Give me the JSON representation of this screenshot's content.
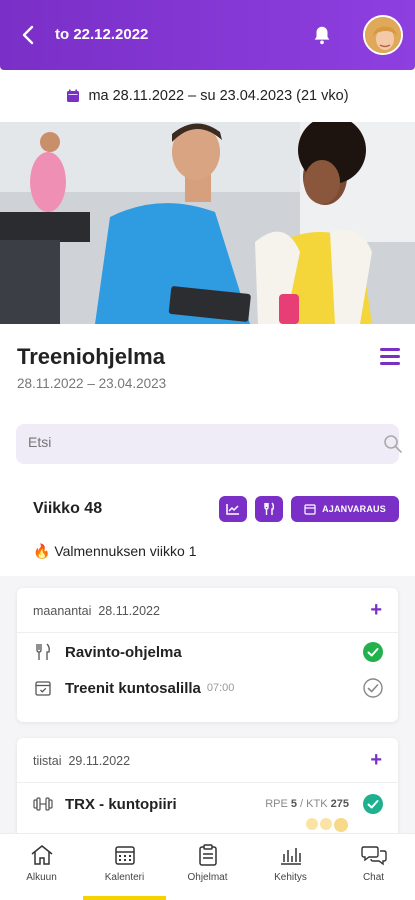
{
  "header": {
    "title": "to 22.12.2022",
    "back_icon": "chevron-left-icon",
    "bell_icon": "bell-icon",
    "avatar": "user-avatar"
  },
  "period": {
    "text": "ma 28.11.2022 – su 23.04.2023 (21 vko)",
    "icon": "calendar-icon"
  },
  "program": {
    "title": "Treeniohjelma",
    "dates": "28.11.2022 – 23.04.2023"
  },
  "search": {
    "placeholder": "Etsi"
  },
  "week": {
    "label": "Viikko 48",
    "booking_label": "AJANVARAUS",
    "coaching_week": "Valmennuksen viikko 1",
    "coaching_icon": "fire-icon"
  },
  "days": [
    {
      "weekday": "maanantai",
      "date": "28.11.2022",
      "items": [
        {
          "name": "Ravinto-ohjelma",
          "time": "",
          "icon": "cutlery-icon",
          "status": "done"
        },
        {
          "name": "Treenit kuntosalilla",
          "time": "07:00",
          "icon": "calendar-check-icon",
          "status": "pending"
        }
      ]
    },
    {
      "weekday": "tiistai",
      "date": "29.11.2022",
      "items": [
        {
          "name": "TRX - kuntopiiri",
          "rpe_label": "RPE",
          "rpe": "5",
          "ktk_label": "KTK",
          "ktk": "275",
          "icon": "dumbbell-icon",
          "status": "done"
        }
      ]
    }
  ],
  "nav": [
    {
      "label": "Alkuun",
      "icon": "home-icon"
    },
    {
      "label": "Kalenteri",
      "icon": "calendar-icon",
      "active": true
    },
    {
      "label": "Ohjelmat",
      "icon": "clipboard-icon"
    },
    {
      "label": "Kehitys",
      "icon": "bar-chart-icon"
    },
    {
      "label": "Chat",
      "icon": "chat-icon"
    }
  ],
  "colors": {
    "primary": "#7a2fc7",
    "success": "#22b14c",
    "nav_active": "#f5d200"
  }
}
